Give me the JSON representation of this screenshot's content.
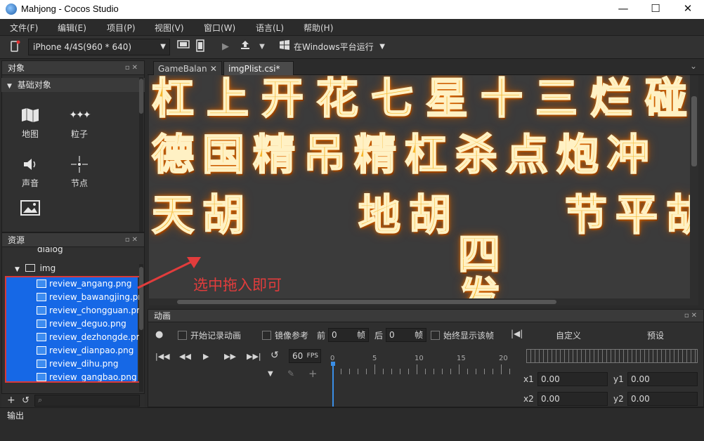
{
  "window": {
    "title": "Mahjong - Cocos Studio",
    "controls": [
      "—",
      "☐",
      "✕"
    ]
  },
  "menu": [
    "文件(F)",
    "编辑(E)",
    "项目(P)",
    "视图(V)",
    "窗口(W)",
    "语言(L)",
    "帮助(H)"
  ],
  "toolbar": {
    "device": "iPhone 4/4S(960 * 640)",
    "run_target": "在Windows平台运行"
  },
  "objects_panel": {
    "title": "对象",
    "section": "基础对象",
    "items": [
      {
        "label": "地图",
        "icon": "map-icon"
      },
      {
        "label": "粒子",
        "icon": "particle-icon"
      },
      {
        "label": "声音",
        "icon": "sound-icon"
      },
      {
        "label": "节点",
        "icon": "node-icon"
      },
      {
        "label": "",
        "icon": "image-icon"
      }
    ]
  },
  "resources_panel": {
    "title": "资源",
    "partial_folder": "dialog",
    "folder": "img",
    "files": [
      "review_angang.png",
      "review_bawangjing.png",
      "review_chongguan.png",
      "review_deguo.png",
      "review_dezhongde.png",
      "review_dianpao.png",
      "review_dihu.png",
      "review_gangbao.png"
    ]
  },
  "tabs": [
    {
      "label": "GameBalance",
      "active": false
    },
    {
      "label": "imgPlist.csi*",
      "active": true
    }
  ],
  "canvas": {
    "annotation": "选中拖入即可",
    "annotation_color": "#e23c3c",
    "rows": [
      "杠上开花七星十三烂碰碰",
      "德国精吊精杠杀点炮冲",
      "天胡 地胡 节平胡七",
      "四",
      "发"
    ]
  },
  "animation_panel": {
    "title": "动画",
    "start_record": "开始记录动画",
    "mirror_ref": "镜像参考",
    "front_label": "前",
    "front_value": "0",
    "back_label": "后",
    "back_value": "0",
    "frame_unit": "帧",
    "always_show": "始终显示该帧",
    "custom": "自定义",
    "preset": "预设",
    "fps_value": "60",
    "fps_unit": "FPS",
    "ruler_labels": [
      "0",
      "5",
      "10",
      "15",
      "20"
    ],
    "fields": [
      {
        "label": "x1",
        "value": "0.00"
      },
      {
        "label": "y1",
        "value": "0.00"
      },
      {
        "label": "x2",
        "value": "0.00"
      },
      {
        "label": "y2",
        "value": "0.00"
      }
    ]
  },
  "output": {
    "label": "输出"
  }
}
